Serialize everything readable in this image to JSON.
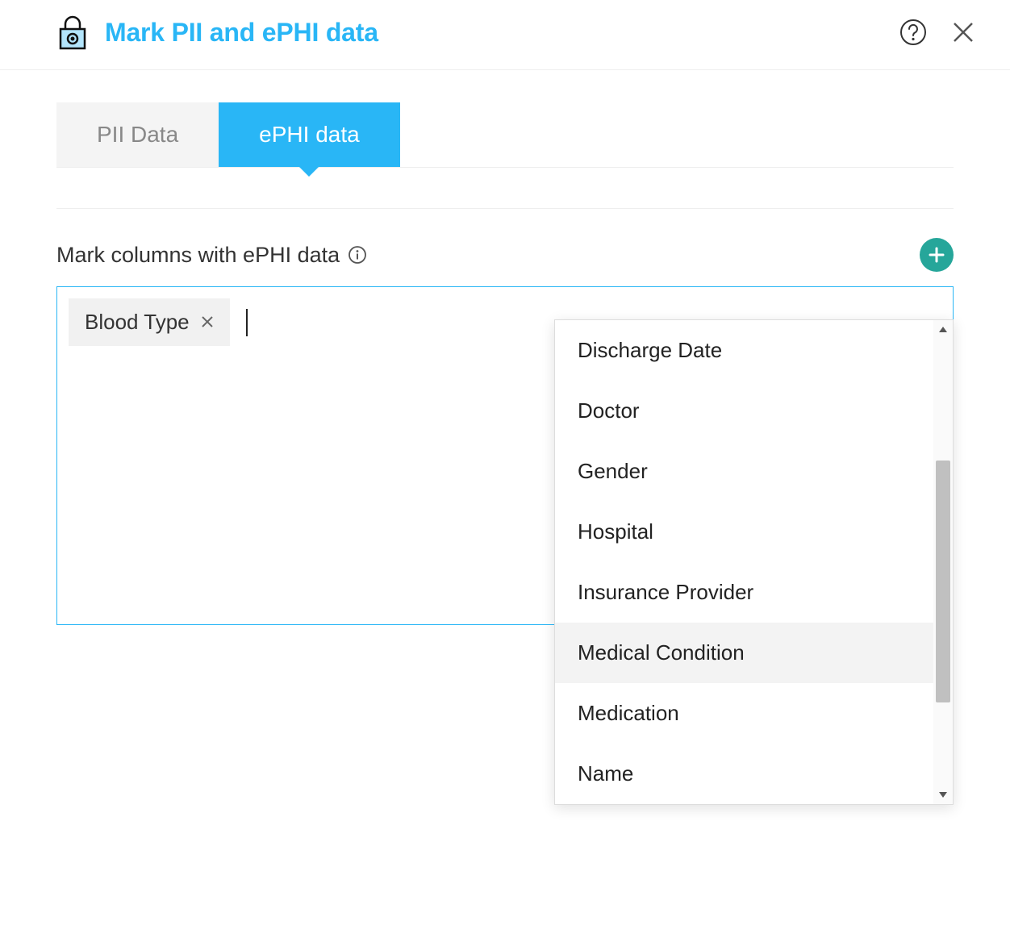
{
  "header": {
    "title": "Mark PII and ePHI data"
  },
  "tabs": {
    "items": [
      {
        "label": "PII Data",
        "active": false
      },
      {
        "label": "ePHI data",
        "active": true
      }
    ]
  },
  "field": {
    "label": "Mark columns with ePHI data"
  },
  "chips": [
    {
      "label": "Blood Type"
    }
  ],
  "dropdown": {
    "items": [
      {
        "label": "Discharge Date",
        "hovered": false
      },
      {
        "label": "Doctor",
        "hovered": false
      },
      {
        "label": "Gender",
        "hovered": false
      },
      {
        "label": "Hospital",
        "hovered": false
      },
      {
        "label": "Insurance Provider",
        "hovered": false
      },
      {
        "label": "Medical Condition",
        "hovered": true
      },
      {
        "label": "Medication",
        "hovered": false
      },
      {
        "label": "Name",
        "hovered": false
      }
    ]
  }
}
